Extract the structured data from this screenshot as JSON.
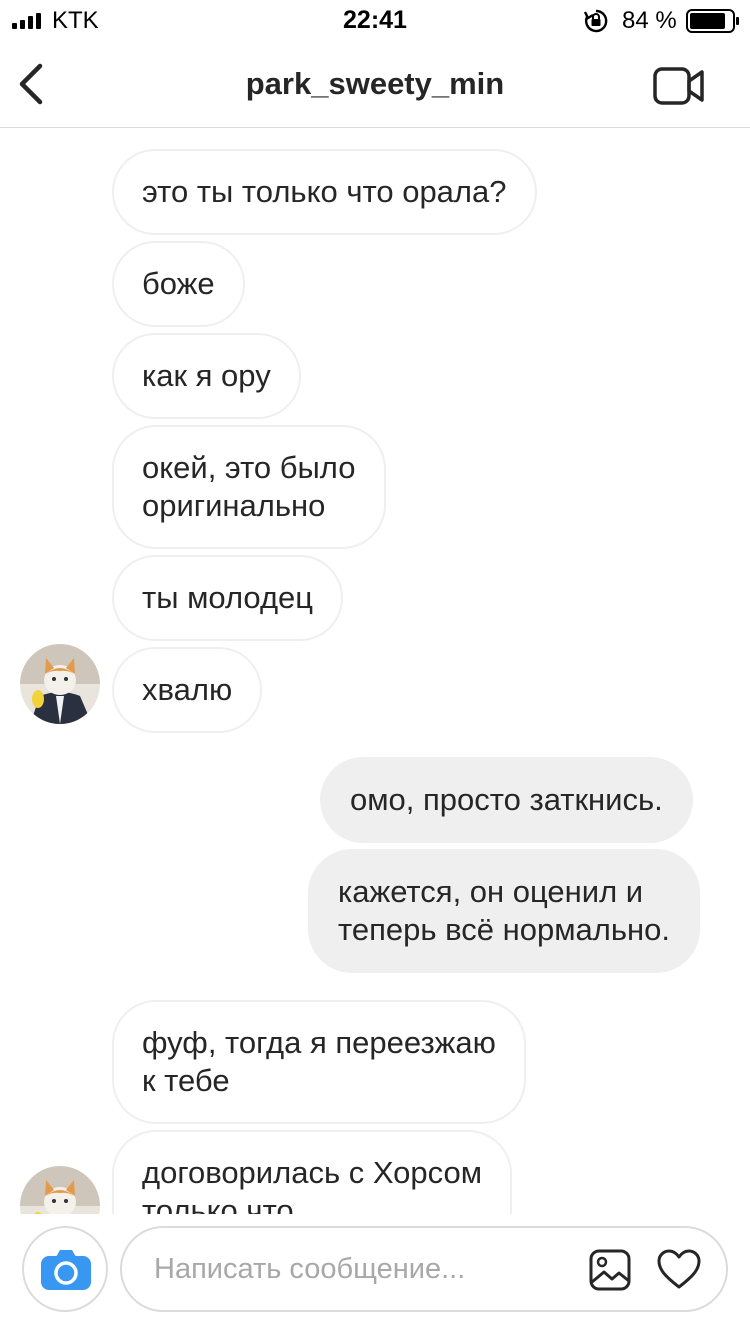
{
  "status_bar": {
    "carrier": "KTK",
    "time": "22:41",
    "battery": "84 %"
  },
  "header": {
    "title": "park_sweety_min",
    "back_icon": "chevron-left-icon",
    "video_icon": "video-camera-icon"
  },
  "messages": [
    {
      "direction": "incoming",
      "text": "это ты только что орала?"
    },
    {
      "direction": "incoming",
      "text": "боже"
    },
    {
      "direction": "incoming",
      "text": "как я ору"
    },
    {
      "direction": "incoming",
      "lines": [
        "окей, это было",
        "оригинально"
      ]
    },
    {
      "direction": "incoming",
      "text": "ты молодец"
    },
    {
      "direction": "incoming",
      "text": "хвалю",
      "avatar": "cat-avatar"
    },
    {
      "direction": "outgoing",
      "text": "омо, просто заткнись."
    },
    {
      "direction": "outgoing",
      "lines": [
        "кажется, он оценил и",
        "теперь всё нормально."
      ]
    },
    {
      "direction": "incoming",
      "lines": [
        "фуф, тогда я переезжаю",
        "к тебе"
      ]
    },
    {
      "direction": "incoming",
      "lines": [
        "договорилась с Хорсом",
        "только что"
      ],
      "avatar": "cat-avatar"
    }
  ],
  "composer": {
    "placeholder": "Написать сообщение...",
    "camera_icon": "camera-icon",
    "gallery_icon": "gallery-icon",
    "like_icon": "heart-icon"
  },
  "colors": {
    "accent": "#3897f0",
    "outgoing_bubble": "#efefef",
    "border": "#dbdbdb",
    "text": "#262626",
    "placeholder": "#a8a8a8"
  }
}
